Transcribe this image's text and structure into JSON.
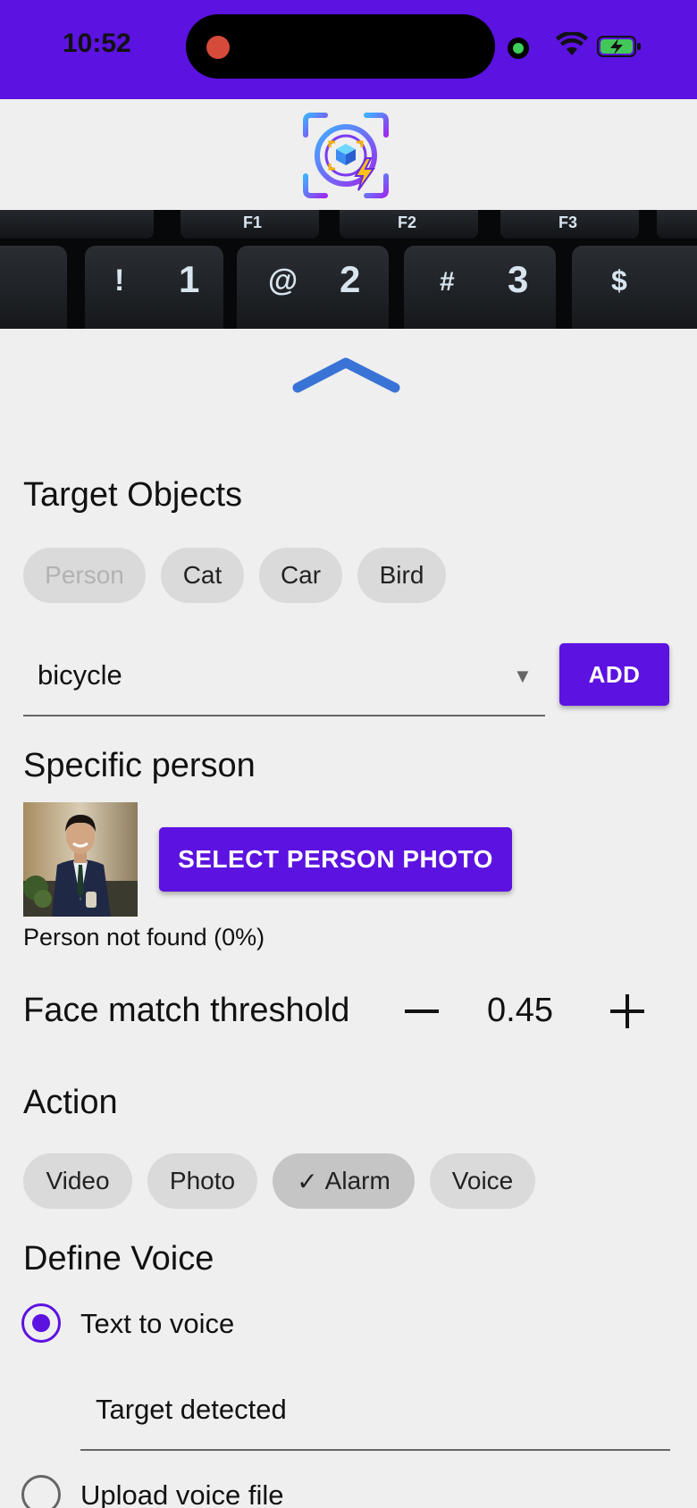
{
  "status_bar": {
    "time": "10:52",
    "background_color": "#5c12e0",
    "icons": [
      "recording-dot-icon",
      "camera-indicator-icon",
      "wifi-icon",
      "battery-charging-icon"
    ]
  },
  "header": {
    "logo_icon": "face-scan-logo-icon"
  },
  "camera_preview": {
    "keys": [
      "F1",
      "F2",
      "F3",
      "!",
      "1",
      "@",
      "2",
      "#",
      "3",
      "$"
    ]
  },
  "collapse_icon": "chevron-up-icon",
  "target_objects": {
    "title": "Target Objects",
    "chips": [
      {
        "label": "Person",
        "state": "disabled"
      },
      {
        "label": "Cat",
        "state": "normal"
      },
      {
        "label": "Car",
        "state": "normal"
      },
      {
        "label": "Bird",
        "state": "normal"
      }
    ],
    "dropdown_value": "bicycle",
    "add_label": "ADD"
  },
  "specific_person": {
    "title": "Specific person",
    "select_label": "SELECT PERSON PHOTO",
    "status": "Person not found (0%)"
  },
  "threshold": {
    "label": "Face match threshold",
    "value": "0.45",
    "minus_icon": "minus-icon",
    "plus_icon": "plus-icon"
  },
  "action": {
    "title": "Action",
    "chips": [
      {
        "label": "Video",
        "selected": false
      },
      {
        "label": "Photo",
        "selected": false
      },
      {
        "label": "Alarm",
        "selected": true
      },
      {
        "label": "Voice",
        "selected": false
      }
    ],
    "check_icon": "✓"
  },
  "define_voice": {
    "title": "Define Voice",
    "option_tts": "Text to voice",
    "tts_value": "Target detected",
    "option_upload": "Upload voice file",
    "selected": "tts"
  },
  "colors": {
    "accent": "#5c12e0",
    "chip_bg": "#dadada",
    "chip_selected_bg": "#c5c5c5",
    "page_bg": "#efefef",
    "chevron": "#3a73d6"
  }
}
